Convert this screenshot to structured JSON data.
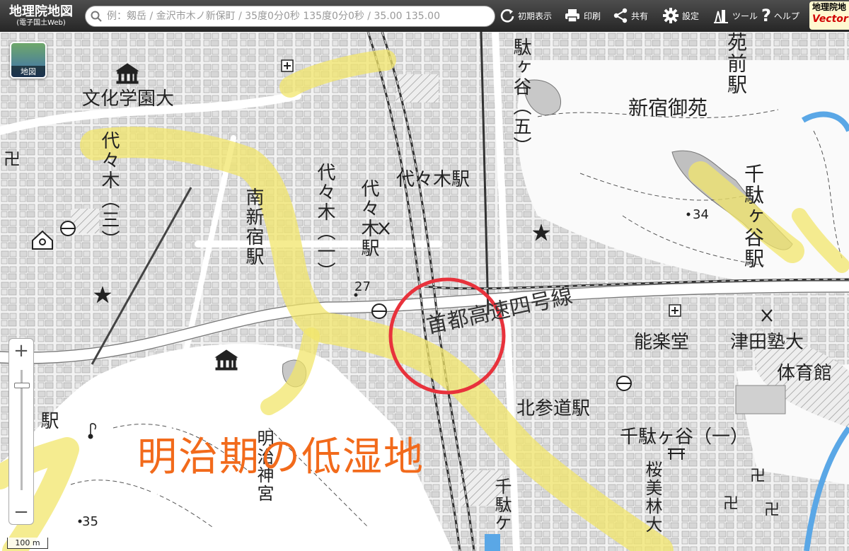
{
  "header": {
    "logo_title": "地理院地図",
    "logo_subtitle": "(電子国土Web)",
    "search_placeholder": "例：剱岳 / 金沢市木ノ新保町 / 35度0分0秒 135度0分0秒 / 35.00 135.00",
    "buttons": {
      "initial_view": "初期表示",
      "print": "印刷",
      "share": "共有",
      "settings": "設定",
      "tools": "ツール",
      "help": "ヘルプ"
    },
    "vector_badge": {
      "line1": "地理院地",
      "line2": "Vector"
    }
  },
  "map": {
    "basemap_button_label": "地図",
    "annotation": "明治期の低湿地",
    "scale_label": "100 m",
    "zoom": {
      "plus": "+",
      "minus": "−"
    },
    "labels": {
      "bunka": "文化学園大",
      "yoyogi3": "代々木（三）",
      "minami_shinjuku": "南新宿駅",
      "yoyogi1": "代々木（一）",
      "yoyogi_eki_v": "代々木駅",
      "yoyogi_eki_h": "代々木駅",
      "elev27": "27",
      "sendagaya5": "駄ヶ谷（五）",
      "shinjuku_gyoen": "新宿御苑",
      "gyoen_mae": "苑前駅",
      "sendagaya_eki": "千駄ヶ谷駅",
      "elev34": "34",
      "shuto4": "首都高速四号線",
      "nogakudo": "能楽堂",
      "tsuda": "津田塾大",
      "taiikukan": "体育館",
      "kitasando": "北参道駅",
      "sendagaya1": "千駄ヶ谷（一）",
      "sakuramibayashi": "桜美林大",
      "sendagaya_v": "千駄ケ",
      "meiji_jingu": "明治神宮",
      "eki_left": "駅",
      "elev35": "35"
    }
  },
  "colors": {
    "lowland": "#f2e66b",
    "highlight_circle": "#e8323c",
    "annotation_text": "#f26a1b",
    "water": "#5aa7e6",
    "topbar": "#333333"
  }
}
